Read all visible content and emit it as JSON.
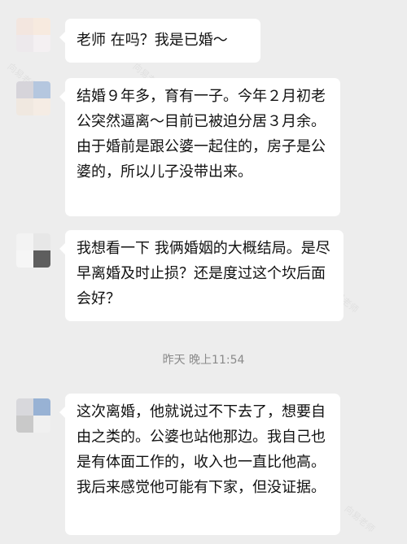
{
  "messages": [
    {
      "text": "老师 在吗？我是已婚～"
    },
    {
      "text": "结婚９年多，育有一子。今年２月初老公突然逼离～目前已被迫分居３月余。由于婚前是跟公婆一起住的，房子是公婆的，所以儿子没带出来。"
    },
    {
      "text": "我想看一下 我俩婚姻的大概结局。是尽早离婚及时止损？还是度过这个坎后面会好？"
    },
    {
      "text": "这次离婚，他就说过不下去了，想要自由之类的。公婆也站他那边。我自己也是有体面工作的，收入也一直比他高。我后来感觉他可能有下家，但没证据。"
    }
  ],
  "timestamp": "昨天 晚上11:54",
  "watermark": "向易老师"
}
